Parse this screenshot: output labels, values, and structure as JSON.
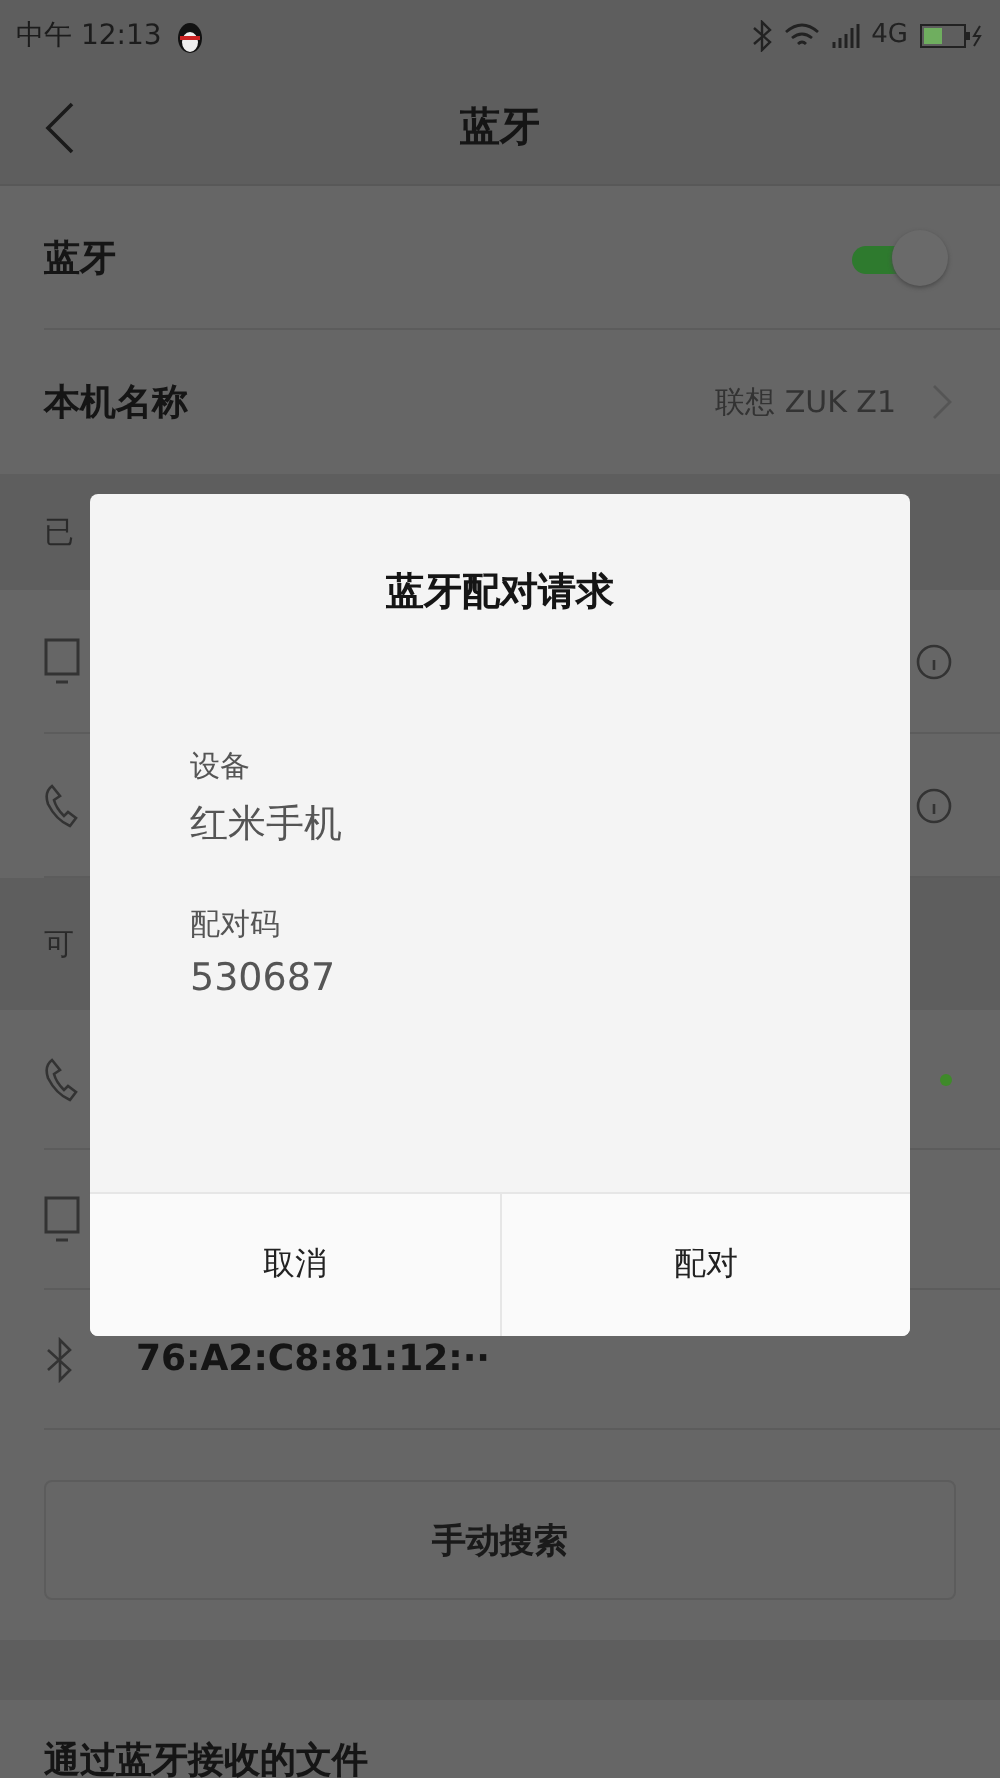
{
  "status_bar": {
    "time": "中午 12:13",
    "network": "4G"
  },
  "header": {
    "title": "蓝牙"
  },
  "settings": [
    {
      "kind": "toggle",
      "label": "蓝牙",
      "on": true
    },
    {
      "kind": "link",
      "label": "本机名称",
      "value": "联想 ZUK Z1"
    }
  ],
  "paired_section": {
    "title": "已",
    "devices": [
      {
        "kind": "monitor"
      },
      {
        "kind": "phone"
      }
    ]
  },
  "available_section": {
    "title": "可",
    "devices": [
      {
        "kind": "phone",
        "connected": true
      },
      {
        "kind": "monitor",
        "connected": false
      },
      {
        "kind": "bluetooth",
        "connected": false,
        "name": "76:A2:C8:81:12:··"
      }
    ]
  },
  "search_button": "手动搜索",
  "received_files": "通过蓝牙接收的文件",
  "dialog": {
    "title": "蓝牙配对请求",
    "fields": [
      {
        "label": "设备",
        "value": "红米手机"
      },
      {
        "label": "配对码",
        "value": "530687"
      }
    ],
    "buttons": [
      "取消",
      "配对"
    ]
  }
}
